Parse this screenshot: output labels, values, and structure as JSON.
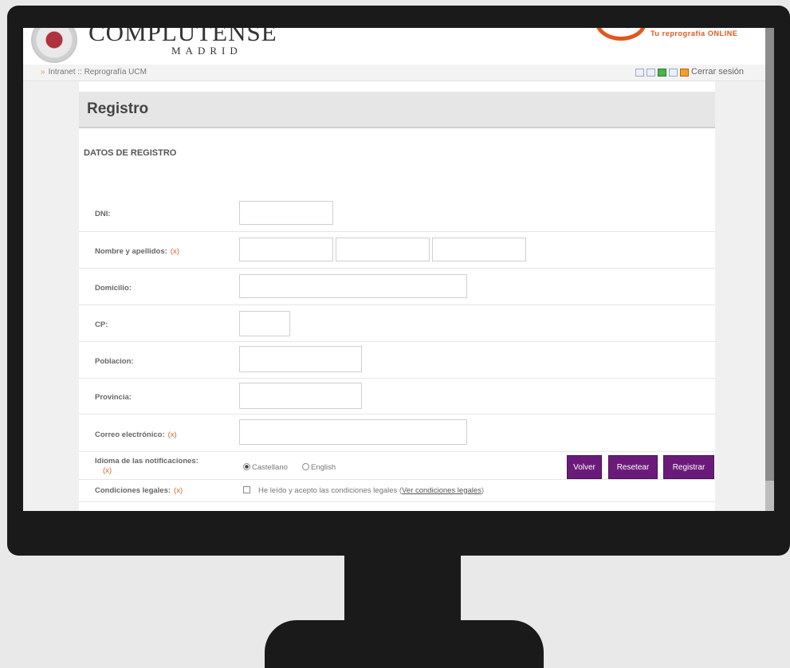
{
  "header": {
    "university_name": "COMPLUTENSE",
    "university_city": "MADRID",
    "repro_tagline": "Tu reprografía ONLINE"
  },
  "nav": {
    "breadcrumb": "Intranet :: Reprografía UCM",
    "logout": "Cerrar sesión"
  },
  "page": {
    "title": "Registro",
    "section": "DATOS DE REGISTRO"
  },
  "form": {
    "required_mark": "(x)",
    "dni_label": "DNI:",
    "nombre_label": "Nombre y apellidos:",
    "domicilio_label": "Domicilio:",
    "cp_label": "CP:",
    "poblacion_label": "Poblacion:",
    "provincia_label": "Provincia:",
    "correo_label": "Correo electrónico:",
    "idioma_label": "Idioma de las notificaciones:",
    "idioma_options": [
      {
        "label": "Castellano",
        "selected": true
      },
      {
        "label": "English",
        "selected": false
      }
    ],
    "condiciones_label": "Condiciones legales:",
    "condiciones_text": "He leído y acepto las condiciones legales",
    "condiciones_link": "Ver condiciones legales"
  },
  "buttons": {
    "volver": "Volver",
    "resetear": "Resetear",
    "registrar": "Registrar"
  },
  "colors": {
    "button_bg": "#6a1b7a",
    "required_mark": "#d0642a",
    "repro_brand": "#e0571d"
  }
}
